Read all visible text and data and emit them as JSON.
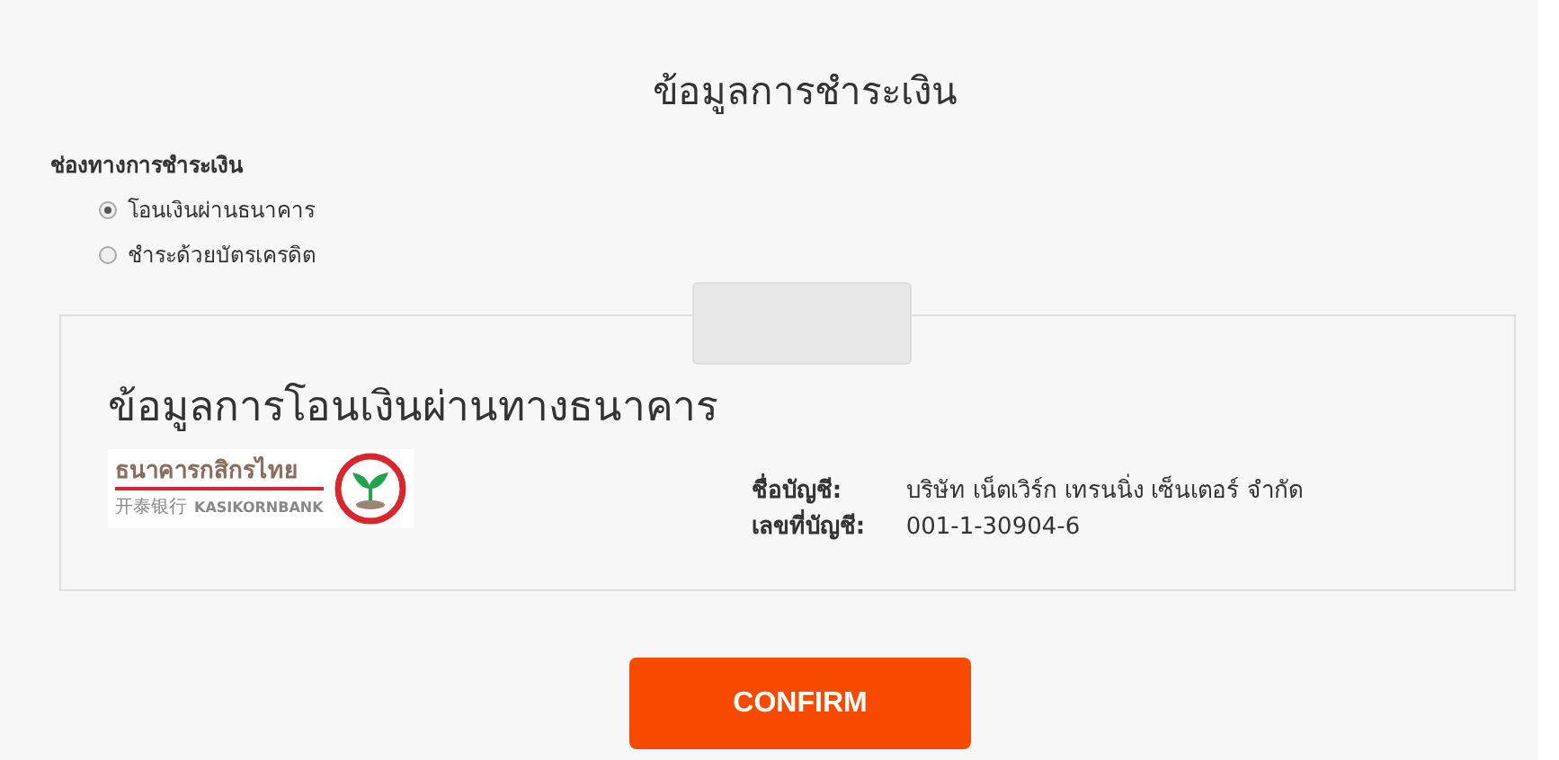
{
  "page_title": "ข้อมูลการชำระเงิน",
  "payment_section": {
    "label": "ช่องทางการชำระเงิน",
    "options": [
      {
        "label": "โอนเงินผ่านธนาคาร",
        "selected": true
      },
      {
        "label": "ชำระด้วยบัตรเครดิต",
        "selected": false
      }
    ]
  },
  "bank_card": {
    "title": "ข้อมูลการโอนเงินผ่านทางธนาคาร",
    "logo": {
      "name_thai": "ธนาคารกสิกรไทย",
      "name_chinese": "开泰银行",
      "name_english": "KASIKORNBANK"
    },
    "fields": [
      {
        "label": "ชื่อบัญชี:",
        "value": "บริษัท เน็ตเวิร์ก เทรนนิ่ง เซ็นเตอร์ จำกัด"
      },
      {
        "label": "เลขที่บัญชี:",
        "value": "001-1-30904-6"
      }
    ]
  },
  "confirm_button": "CONFIRM"
}
